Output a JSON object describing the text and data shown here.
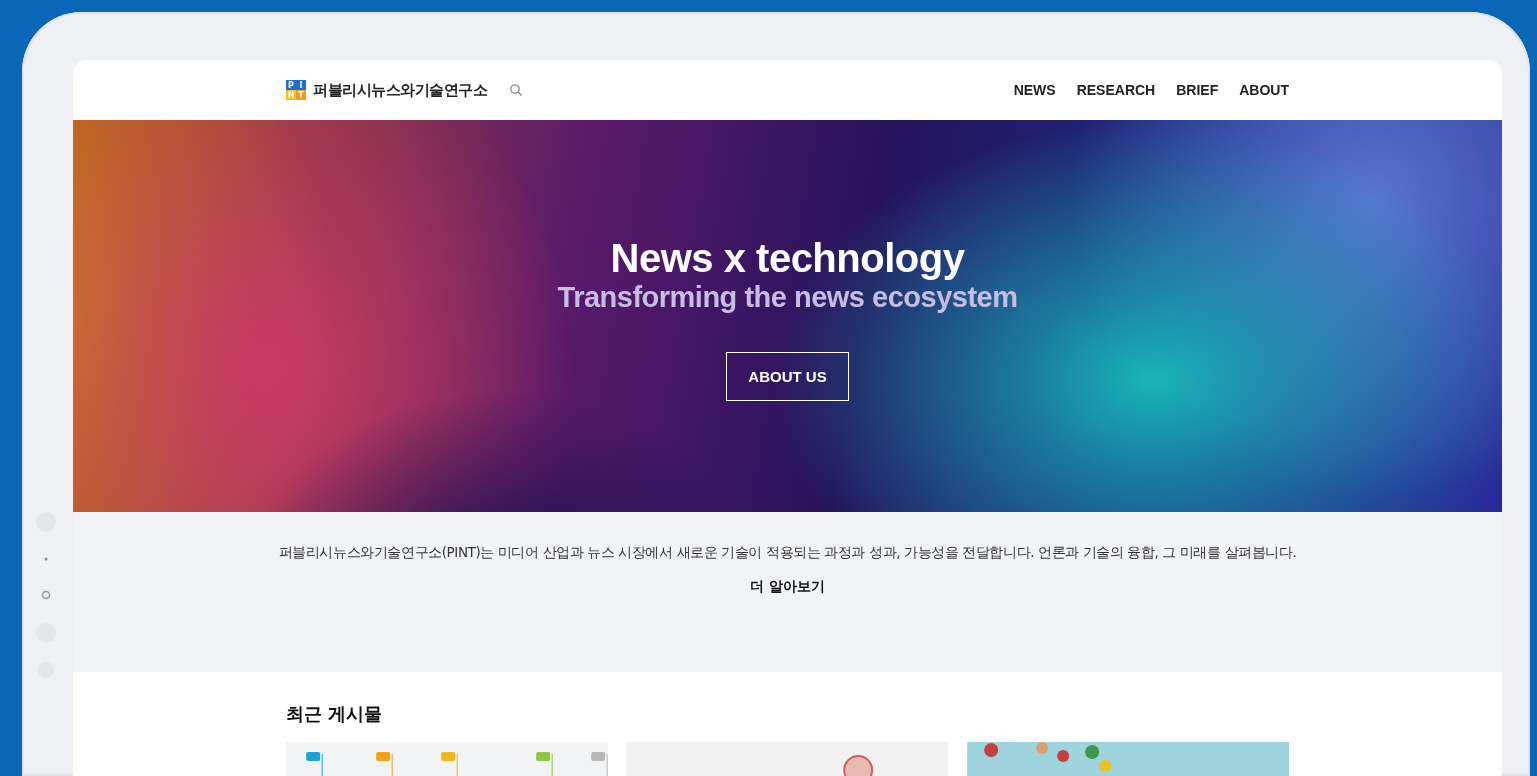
{
  "header": {
    "logo_tiles": [
      {
        "letter": "P",
        "color": "#1f6fd6"
      },
      {
        "letter": "I",
        "color": "#1f6fd6"
      },
      {
        "letter": "N",
        "color": "#f2c417"
      },
      {
        "letter": "T",
        "color": "#f39a1e"
      }
    ],
    "site_name": "퍼블리시뉴스와기술연구소",
    "nav": [
      "NEWS",
      "RESEARCH",
      "BRIEF",
      "ABOUT"
    ]
  },
  "hero": {
    "title": "News x technology",
    "subtitle": "Transforming the news ecosystem",
    "button": "ABOUT US"
  },
  "intro": {
    "text": "퍼블리시뉴스와기술연구소(PINT)는 미디어 산업과 뉴스 시장에서 새로운 기술이 적용되는 과정과 성과, 가능성을 전달합니다. 언론과 기술의 융합, 그 미래를 살펴봅니다.",
    "link": "더 알아보기"
  },
  "recent": {
    "heading": "최근 게시물",
    "posts": [
      {
        "kind": "infographic"
      },
      {
        "kind": "photo-light"
      },
      {
        "kind": "photo-pieces"
      }
    ]
  }
}
